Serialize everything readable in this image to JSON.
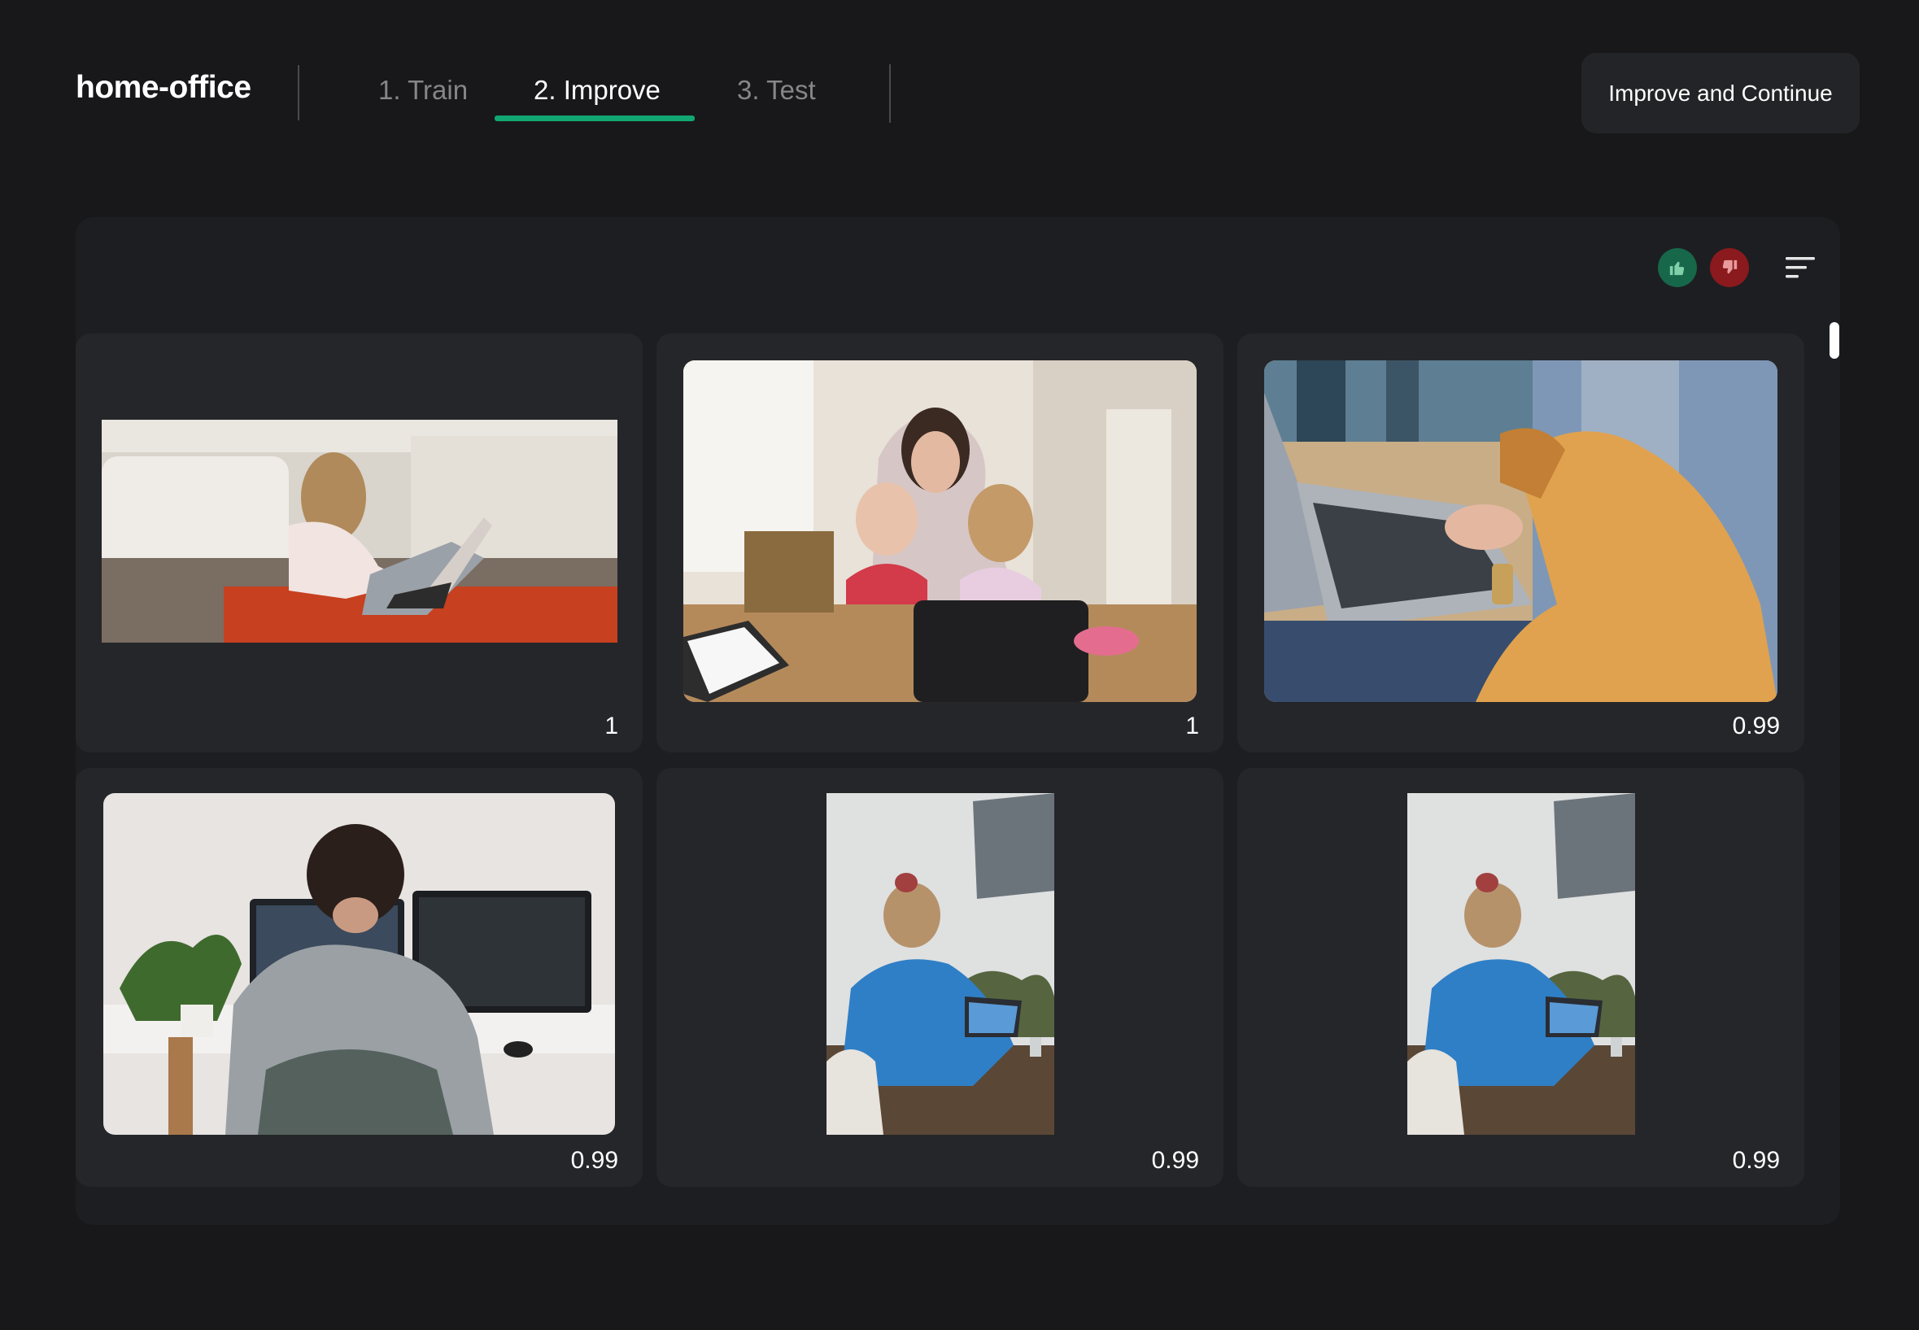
{
  "header": {
    "project_title": "home-office",
    "tabs": [
      {
        "label": "1. Train",
        "active": false
      },
      {
        "label": "2. Improve",
        "active": true
      },
      {
        "label": "3. Test",
        "active": false
      }
    ],
    "primary_button_label": "Improve and Continue",
    "accent_color": "#12a772"
  },
  "toolbar": {
    "thumbs_up_icon": "thumbs-up-icon",
    "thumbs_down_icon": "thumbs-down-icon",
    "sort_icon": "sort-icon",
    "thumbs_up_color": "#17674b",
    "thumbs_down_color": "#8a1a1d"
  },
  "results": [
    {
      "score": "1"
    },
    {
      "score": "1"
    },
    {
      "score": "0.99"
    },
    {
      "score": "0.99"
    },
    {
      "score": "0.99"
    },
    {
      "score": "0.99"
    }
  ]
}
